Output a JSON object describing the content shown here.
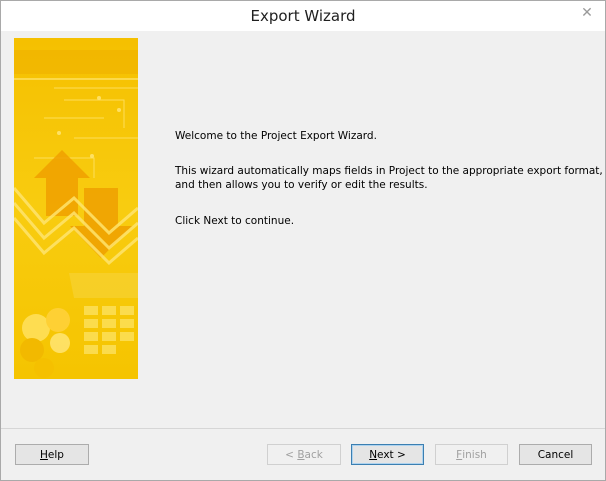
{
  "window": {
    "title": "Export Wizard",
    "close_symbol": "✕"
  },
  "content": {
    "welcome": "Welcome to the Project Export Wizard.",
    "description_line1": "This wizard automatically maps fields in Project to the appropriate export format,",
    "description_line2": "and then allows you to verify or edit the results.",
    "instruction": "Click Next to continue."
  },
  "buttons": {
    "help": {
      "mnemonic": "H",
      "rest": "elp"
    },
    "back": {
      "prefix": "< ",
      "mnemonic": "B",
      "rest": "ack"
    },
    "next": {
      "mnemonic": "N",
      "rest": "ext >"
    },
    "finish": {
      "mnemonic": "F",
      "rest": "inish"
    },
    "cancel": "Cancel"
  },
  "colors": {
    "art_primary": "#f7c800",
    "art_light": "#ffe04a",
    "art_dark": "#f0a800"
  },
  "icons": {
    "close": "close-icon",
    "side_art": "wizard-side-illustration"
  }
}
